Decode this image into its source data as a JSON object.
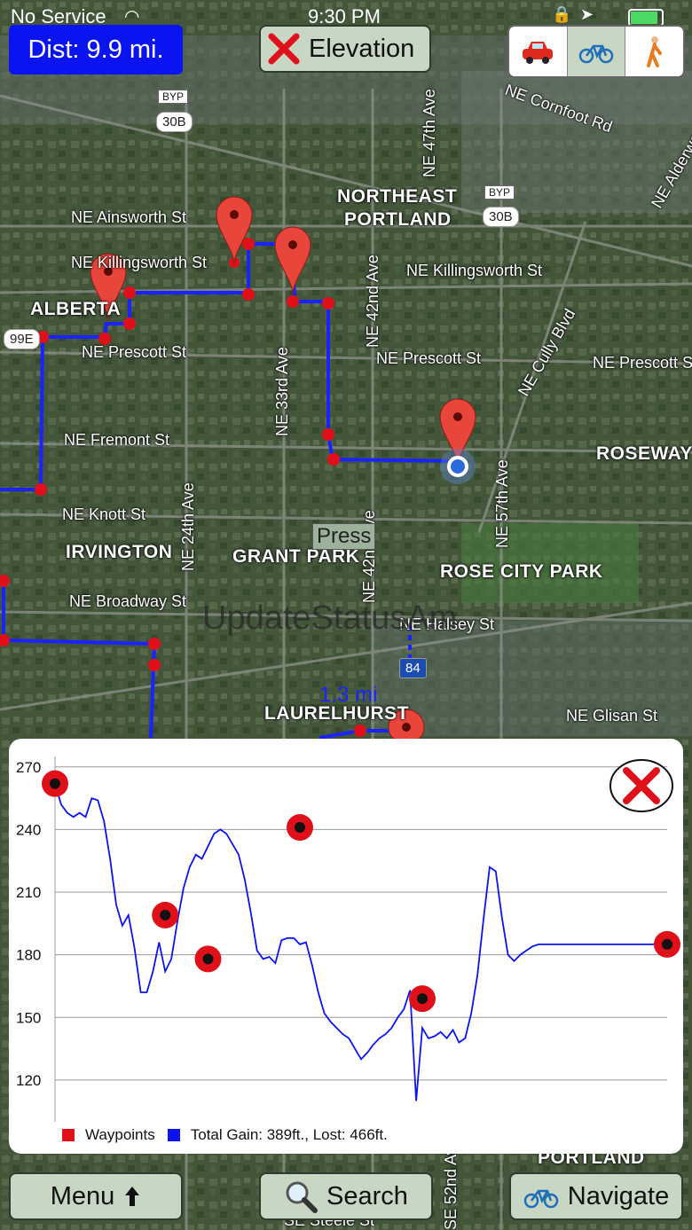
{
  "status": {
    "carrier": "No Service",
    "time": "9:30 PM"
  },
  "toolbar": {
    "distance_label": "Dist: 9.9 mi.",
    "elevation_label": "Elevation",
    "travel_modes": [
      "car",
      "bike",
      "walk"
    ],
    "selected_mode": "bike"
  },
  "map": {
    "labels": {
      "cornfoot": "NE Cornfoot Rd",
      "alderwood": "NE Alderwo",
      "ainsworth": "NE Ainsworth St",
      "killingsworth_w": "NE Killingsworth St",
      "killingsworth_e": "NE Killingsworth St",
      "alberta": "ALBERTA",
      "prescott_w": "NE Prescott St",
      "prescott_m": "NE Prescott St",
      "prescott_e": "NE Prescott St",
      "fremont": "NE Fremont St",
      "roseway": "ROSEWAY",
      "knott": "NE Knott St",
      "irvington": "IRVINGTON",
      "grant_park": "GRANT PARK",
      "rose_city": "ROSE CITY PARK",
      "broadway": "NE Broadway St",
      "halsey": "NE Halsey St",
      "laurelhurst": "LAURELHURST",
      "glisan": "NE Glisan St",
      "ne_portland_1": "NORTHEAST",
      "ne_portland_2": "PORTLAND",
      "ave_47": "NE 47th Ave",
      "ave_42": "NE 42nd Ave",
      "ave_33": "NE 33rd Ave",
      "ave_24": "NE 24th Ave",
      "ave_57": "NE 57th Ave",
      "ave_42b": "NE 42nd Ave",
      "ave_52": "SE 52nd Ave",
      "cully": "NE Cully Blvd",
      "portland_bottom": "PORTLAND",
      "steele": "SE Steele St"
    },
    "shields": {
      "byp": "BYP",
      "r30b": "30B",
      "r99e": "99E",
      "i84": "84"
    },
    "press_label": "Press",
    "overlay_text": "UpdateStatusAm",
    "segment_distance": "1.3 mi"
  },
  "elevation_panel": {
    "legend_waypoints": "Waypoints",
    "legend_gain": "Total Gain: 389ft., Lost: 466ft."
  },
  "chart_data": {
    "type": "line",
    "title": "",
    "xlabel": "",
    "ylabel": "",
    "ylim": [
      100,
      275
    ],
    "yticks": [
      120,
      150,
      180,
      210,
      240,
      270
    ],
    "grid": true,
    "legend_placement": "bottom",
    "colors": {
      "profile": "#0a14f0",
      "waypoint": "#e0101a"
    },
    "x": [
      0,
      1,
      2,
      3,
      4,
      5,
      6,
      7,
      8,
      9,
      10,
      11,
      12,
      13,
      14,
      15,
      16,
      17,
      18,
      19,
      20,
      21,
      22,
      23,
      24,
      25,
      26,
      27,
      28,
      29,
      30,
      31,
      32,
      33,
      34,
      35,
      36,
      37,
      38,
      39,
      40,
      41,
      42,
      43,
      44,
      45,
      46,
      47,
      48,
      49,
      50,
      51,
      52,
      53,
      54,
      55,
      56,
      57,
      58,
      59,
      60,
      61,
      62,
      63,
      64,
      65,
      66,
      67,
      68,
      69,
      70,
      71,
      72,
      73,
      74,
      75,
      76,
      77,
      78,
      79,
      80,
      81,
      82,
      83,
      84,
      85,
      86,
      87,
      88,
      89,
      90,
      91,
      92,
      93,
      94,
      95,
      96,
      97,
      98,
      99,
      100
    ],
    "series": [
      {
        "values": [
          262,
          252,
          248,
          246,
          248,
          246,
          255,
          254,
          244,
          226,
          204,
          194,
          199,
          183,
          162,
          162,
          172,
          186,
          172,
          178,
          196,
          212,
          222,
          228,
          226,
          232,
          238,
          240,
          238,
          233,
          228,
          216,
          200,
          182,
          178,
          179,
          176,
          187,
          188,
          188,
          185,
          186,
          175,
          162,
          152,
          148,
          145,
          142,
          140,
          135,
          130,
          133,
          137,
          140,
          142,
          145,
          150,
          154,
          163,
          110,
          145,
          140,
          141,
          143,
          140,
          144,
          138,
          140,
          152,
          170,
          197,
          222,
          220,
          198,
          180,
          177,
          180,
          182,
          184,
          185,
          185,
          185,
          185,
          185,
          185,
          185,
          185,
          185,
          185,
          185,
          185,
          185,
          185,
          185,
          185,
          185,
          185,
          185,
          185,
          185,
          185
        ]
      }
    ],
    "waypoints": [
      {
        "x": 0,
        "y": 262
      },
      {
        "x": 18,
        "y": 199
      },
      {
        "x": 25,
        "y": 178
      },
      {
        "x": 40,
        "y": 241
      },
      {
        "x": 60,
        "y": 159
      },
      {
        "x": 100,
        "y": 185
      }
    ]
  },
  "bottom_bar": {
    "menu_label": "Menu",
    "search_label": "Search",
    "navigate_label": "Navigate"
  }
}
